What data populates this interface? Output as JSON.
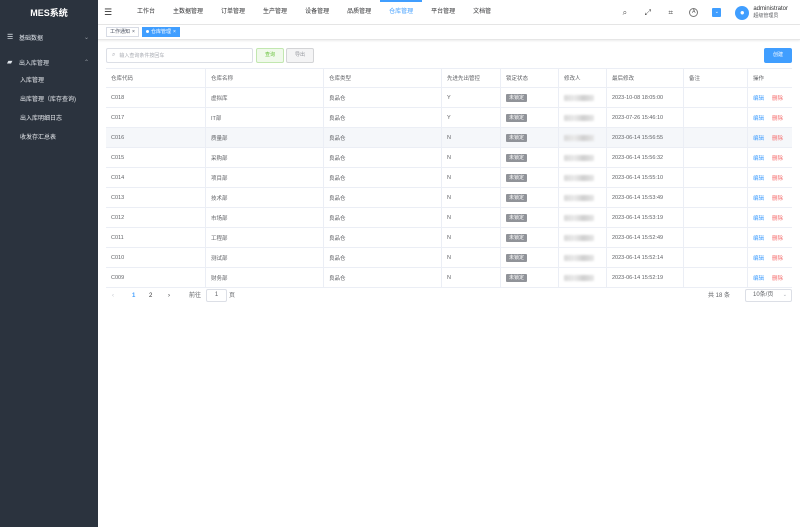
{
  "sidebar": {
    "logo": "MES系统",
    "groups": [
      {
        "label": "基础数据",
        "icon": "list-icon"
      },
      {
        "label": "出入库管理",
        "icon": "folder-icon"
      }
    ],
    "sub_items": [
      "入库管理",
      "出库管理（库存查询)",
      "出入库明细日志",
      "收发存汇总表"
    ]
  },
  "topbar": {
    "nav": [
      "工作台",
      "主数据管理",
      "订单管理",
      "生产管理",
      "设备管理",
      "品质管理",
      "仓库管理",
      "平台管理",
      "文档管"
    ],
    "active_nav": "仓库管理",
    "user_name": "administrator",
    "user_role": "超级管理员"
  },
  "tags": [
    {
      "label": "工作通知",
      "active": false
    },
    {
      "label": "仓库管理",
      "active": true
    }
  ],
  "search": {
    "placeholder": "输入查询条件按回车",
    "query_label": "查询",
    "export_label": "导出",
    "create_label": "创建"
  },
  "table": {
    "columns": [
      "仓库代码",
      "仓库名称",
      "仓库类型",
      "先进先出管控",
      "锁定状态",
      "修改人",
      "最后修改",
      "备注",
      "操作"
    ],
    "edit_label": "编辑",
    "delete_label": "删除",
    "rows": [
      {
        "code": "C018",
        "name": "虚拟库",
        "type": "良品仓",
        "fifo": "Y",
        "lock": "未锁定",
        "time": "2023-10-08 18:05:00",
        "remark": ""
      },
      {
        "code": "C017",
        "name": "IT部",
        "type": "良品仓",
        "fifo": "Y",
        "lock": "未锁定",
        "time": "2023-07-26 15:46:10",
        "remark": ""
      },
      {
        "code": "C016",
        "name": "质量部",
        "type": "良品仓",
        "fifo": "N",
        "lock": "未锁定",
        "time": "2023-06-14 15:56:55",
        "remark": ""
      },
      {
        "code": "C015",
        "name": "采购部",
        "type": "良品仓",
        "fifo": "N",
        "lock": "未锁定",
        "time": "2023-06-14 15:56:32",
        "remark": ""
      },
      {
        "code": "C014",
        "name": "项目部",
        "type": "良品仓",
        "fifo": "N",
        "lock": "未锁定",
        "time": "2023-06-14 15:55:10",
        "remark": ""
      },
      {
        "code": "C013",
        "name": "技术部",
        "type": "良品仓",
        "fifo": "N",
        "lock": "未锁定",
        "time": "2023-06-14 15:53:49",
        "remark": ""
      },
      {
        "code": "C012",
        "name": "市场部",
        "type": "良品仓",
        "fifo": "N",
        "lock": "未锁定",
        "time": "2023-06-14 15:53:19",
        "remark": ""
      },
      {
        "code": "C011",
        "name": "工程部",
        "type": "良品仓",
        "fifo": "N",
        "lock": "未锁定",
        "time": "2023-06-14 15:52:49",
        "remark": ""
      },
      {
        "code": "C010",
        "name": "测试部",
        "type": "良品仓",
        "fifo": "N",
        "lock": "未锁定",
        "time": "2023-06-14 15:52:14",
        "remark": ""
      },
      {
        "code": "C009",
        "name": "财务部",
        "type": "良品仓",
        "fifo": "N",
        "lock": "未锁定",
        "time": "2023-06-14 15:52:19",
        "remark": ""
      }
    ]
  },
  "pagination": {
    "pages": [
      "1",
      "2"
    ],
    "current": "1",
    "goto_label": "前往",
    "goto_value": "1",
    "page_suffix": "页",
    "total": "共 18 条",
    "page_size": "10条/页"
  },
  "colors": {
    "sidebar_bg": "#2b333e",
    "accent": "#409eff",
    "danger": "#f56c6c",
    "success": "#67c23a"
  }
}
